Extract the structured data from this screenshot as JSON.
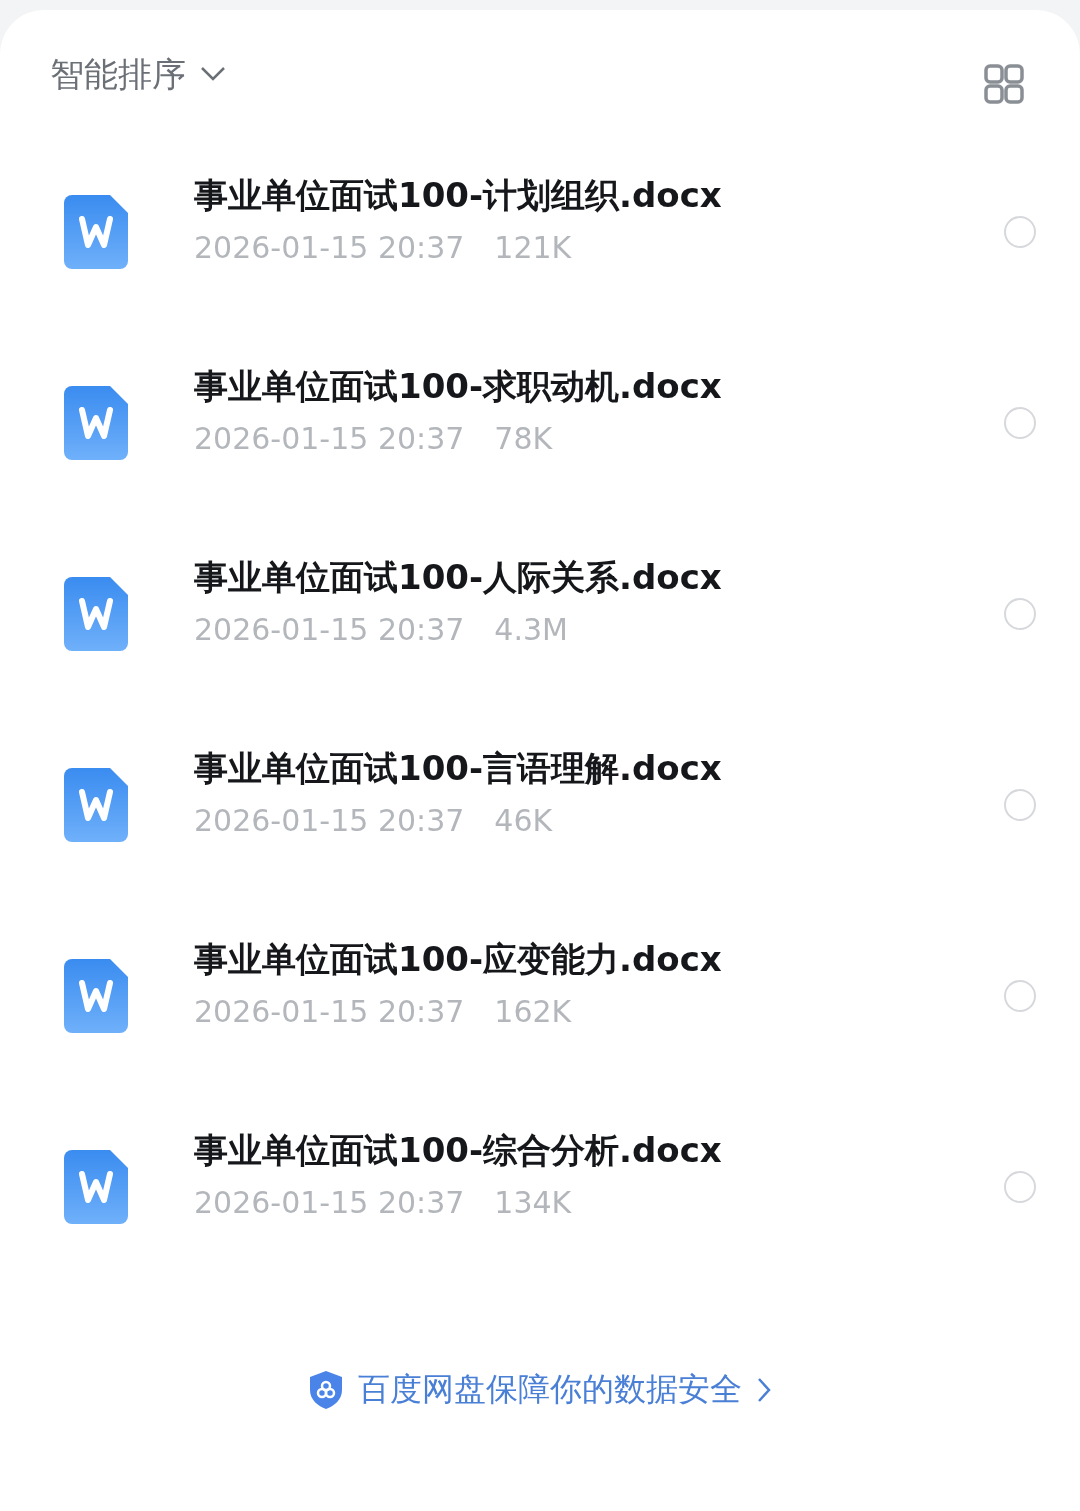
{
  "header": {
    "sort_label": "智能排序"
  },
  "files": [
    {
      "name": "事业单位面试100-计划组织.docx",
      "date": "2026-01-15 20:37",
      "size": "121K",
      "selected": false
    },
    {
      "name": "事业单位面试100-求职动机.docx",
      "date": "2026-01-15 20:37",
      "size": "78K",
      "selected": false
    },
    {
      "name": "事业单位面试100-人际关系.docx",
      "date": "2026-01-15 20:37",
      "size": "4.3M",
      "selected": false
    },
    {
      "name": "事业单位面试100-言语理解.docx",
      "date": "2026-01-15 20:37",
      "size": "46K",
      "selected": false
    },
    {
      "name": "事业单位面试100-应变能力.docx",
      "date": "2026-01-15 20:37",
      "size": "162K",
      "selected": false
    },
    {
      "name": "事业单位面试100-综合分析.docx",
      "date": "2026-01-15 20:37",
      "size": "134K",
      "selected": false
    }
  ],
  "footer": {
    "text": "百度网盘保障你的数据安全"
  }
}
